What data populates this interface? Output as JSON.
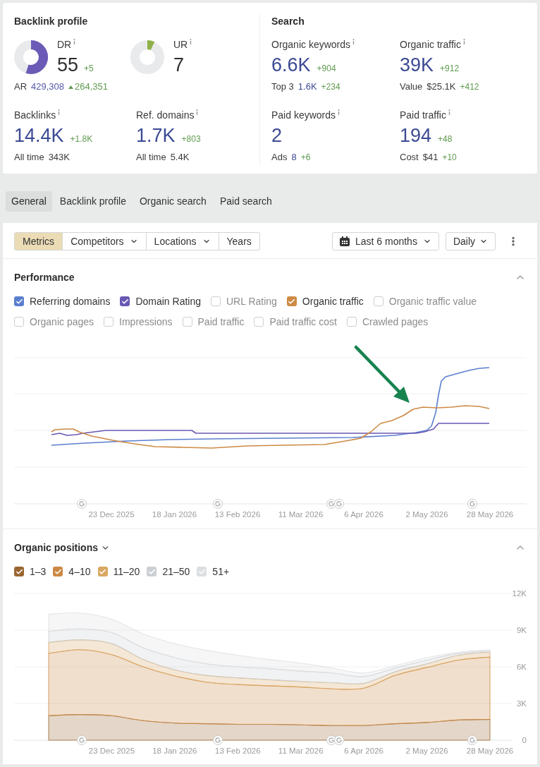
{
  "backlink_profile": {
    "title": "Backlink profile",
    "ratings": [
      {
        "label": "DR",
        "value": "55",
        "change": "+5",
        "color": "#6b5bb6"
      },
      {
        "label": "UR",
        "value": "7",
        "color": "#8fb04a"
      }
    ],
    "ar": {
      "label": "AR",
      "value": "429,308",
      "change": "264,351"
    },
    "stats": [
      {
        "label": "Backlinks",
        "value": "14.4K",
        "change": "+1.8K",
        "sub_label": "All time",
        "sub_value": "343K",
        "sub_value_link": false
      },
      {
        "label": "Ref. domains",
        "value": "1.7K",
        "change": "+803",
        "sub_label": "All time",
        "sub_value": "5.4K",
        "sub_value_link": false
      }
    ]
  },
  "search": {
    "title": "Search",
    "stats": [
      {
        "label": "Organic keywords",
        "value": "6.6K",
        "change": "+904",
        "sub_label": "Top 3",
        "sub_value": "1.6K",
        "sub_change": "+234",
        "sub_value_link": true
      },
      {
        "label": "Organic traffic",
        "value": "39K",
        "change": "+912",
        "sub_label": "Value",
        "sub_value": "$25.1K",
        "sub_change": "+412",
        "sub_value_link": false
      },
      {
        "label": "Paid keywords",
        "value": "2",
        "sub_label": "Ads",
        "sub_value": "8",
        "sub_change": "+6",
        "sub_value_link": true
      },
      {
        "label": "Paid traffic",
        "value": "194",
        "change": "+48",
        "sub_label": "Cost",
        "sub_value": "$41",
        "sub_change": "+10",
        "sub_value_link": false
      }
    ]
  },
  "tabs": [
    {
      "label": "General",
      "selected": true
    },
    {
      "label": "Backlink profile",
      "selected": false
    },
    {
      "label": "Organic search",
      "selected": false
    },
    {
      "label": "Paid search",
      "selected": false
    }
  ],
  "toolbar": {
    "filters": [
      {
        "label": "Metrics",
        "kind": "toggle",
        "selected": true
      },
      {
        "label": "Competitors",
        "kind": "dropdown",
        "selected": false
      },
      {
        "label": "Locations",
        "kind": "dropdown",
        "selected": false
      },
      {
        "label": "Years",
        "kind": "toggle",
        "selected": false
      }
    ],
    "date_range": "Last 6 months",
    "interval": "Daily"
  },
  "performance": {
    "title": "Performance",
    "legend": [
      {
        "label": "Referring domains",
        "checked": true,
        "color": "#5b7fcf"
      },
      {
        "label": "Domain Rating",
        "checked": true,
        "color": "#6a59b3"
      },
      {
        "label": "URL Rating",
        "checked": false
      },
      {
        "label": "Organic traffic",
        "checked": true,
        "color": "#cd8a45"
      },
      {
        "label": "Organic traffic value",
        "checked": false
      },
      {
        "label": "Organic pages",
        "checked": false
      },
      {
        "label": "Impressions",
        "checked": false
      },
      {
        "label": "Paid traffic",
        "checked": false
      },
      {
        "label": "Paid traffic cost",
        "checked": false
      },
      {
        "label": "Crawled pages",
        "checked": false
      }
    ],
    "x_labels": [
      "23 Dec 2025",
      "18 Jan 2026",
      "13 Feb 2026",
      "11 Mar 2026",
      "6 Apr 2026",
      "2 May 2026",
      "28 May 2026"
    ]
  },
  "organic_positions": {
    "title": "Organic positions",
    "legend": [
      {
        "checked": true
      },
      {
        "checked": true
      },
      {
        "checked": true
      },
      {
        "checked": true
      },
      {
        "checked": true
      }
    ],
    "chart_data": {
      "type": "area",
      "stacked": true,
      "grid": true,
      "categories": [
        null,
        null,
        "23 Dec 2025",
        null,
        "18 Jan 2026",
        null,
        "13 Feb 2026",
        null,
        "11 Mar 2026",
        null,
        "6 Apr 2026",
        null,
        "2 May 2026",
        null,
        "28 May 2026"
      ],
      "ylim": [
        0,
        12000
      ],
      "yticks": [
        {
          "value": 0,
          "label": "0"
        },
        {
          "value": 3000,
          "label": "3K"
        },
        {
          "value": 6000,
          "label": "6K"
        },
        {
          "value": 9000,
          "label": "9K"
        },
        {
          "value": 12000,
          "label": "12K"
        }
      ],
      "series": [
        {
          "name": "1–3",
          "color": "#9a6733",
          "values": [
            2000,
            2100,
            2000,
            1600,
            1400,
            1350,
            1300,
            1300,
            1250,
            1200,
            1200,
            1350,
            1450,
            1650,
            1700
          ]
        },
        {
          "name": "4–10",
          "color": "#cc8946",
          "values": [
            5100,
            5300,
            5000,
            4400,
            3850,
            3400,
            3250,
            3150,
            3100,
            3000,
            3050,
            3950,
            4500,
            4900,
            5100
          ]
        },
        {
          "name": "11–20",
          "color": "#d9a862",
          "values": [
            900,
            800,
            900,
            600,
            500,
            550,
            550,
            500,
            450,
            500,
            400,
            300,
            300,
            400,
            400
          ]
        },
        {
          "name": "21–50",
          "color": "#ccd0d4",
          "values": [
            900,
            900,
            900,
            950,
            1000,
            950,
            900,
            900,
            850,
            800,
            550,
            300,
            300,
            150,
            100
          ]
        },
        {
          "name": "51+",
          "color": "#dcdfe2",
          "values": [
            1400,
            1300,
            1100,
            1150,
            1150,
            1100,
            950,
            750,
            650,
            400,
            300,
            200,
            200,
            100,
            100
          ]
        }
      ]
    }
  }
}
